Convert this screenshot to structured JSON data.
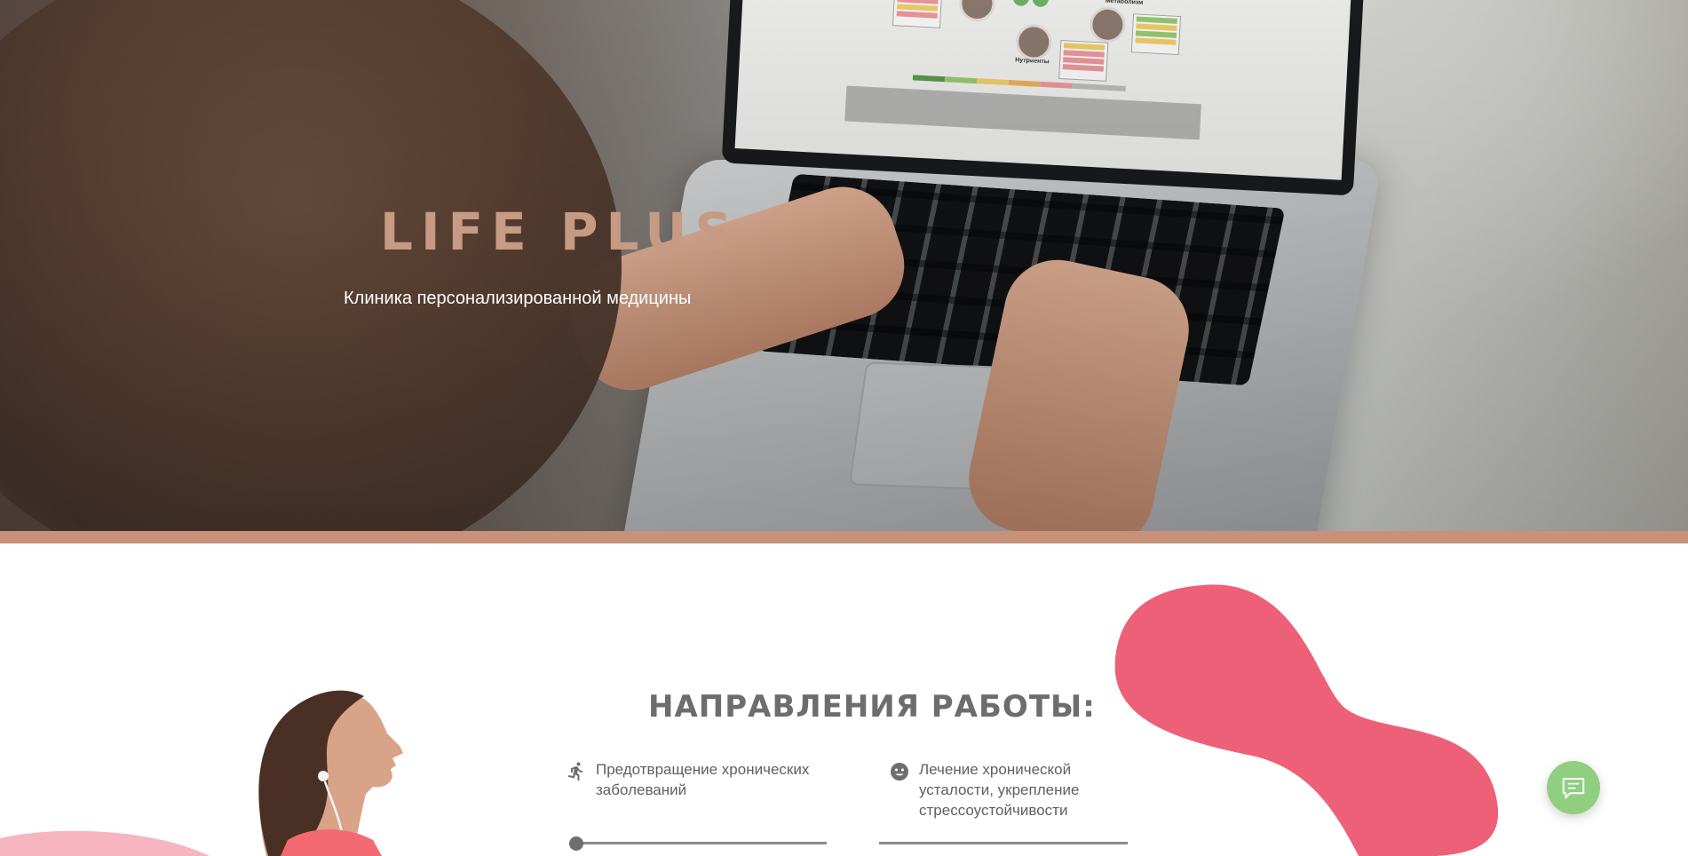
{
  "hero": {
    "brand": "LIFE PLUS",
    "tagline": "Клиника персонализированной медицины"
  },
  "section": {
    "title": "НАПРАВЛЕНИЯ РАБОТЫ:",
    "directions": [
      {
        "label": "Предотвращение хронических заболеваний",
        "icon": "running-person-icon"
      },
      {
        "label": "Лечение хронической усталости, укрепление стрессоустойчивости",
        "icon": "face-icon"
      }
    ]
  },
  "colors": {
    "brand": "#c79a83",
    "accent_stripe": "#c8917a",
    "blob": "#ee6078",
    "chat_button": "#8fcf7f",
    "text_gray": "#6d6d6d"
  },
  "widgets": {
    "chat_button_icon": "chat-bubble-icon"
  }
}
